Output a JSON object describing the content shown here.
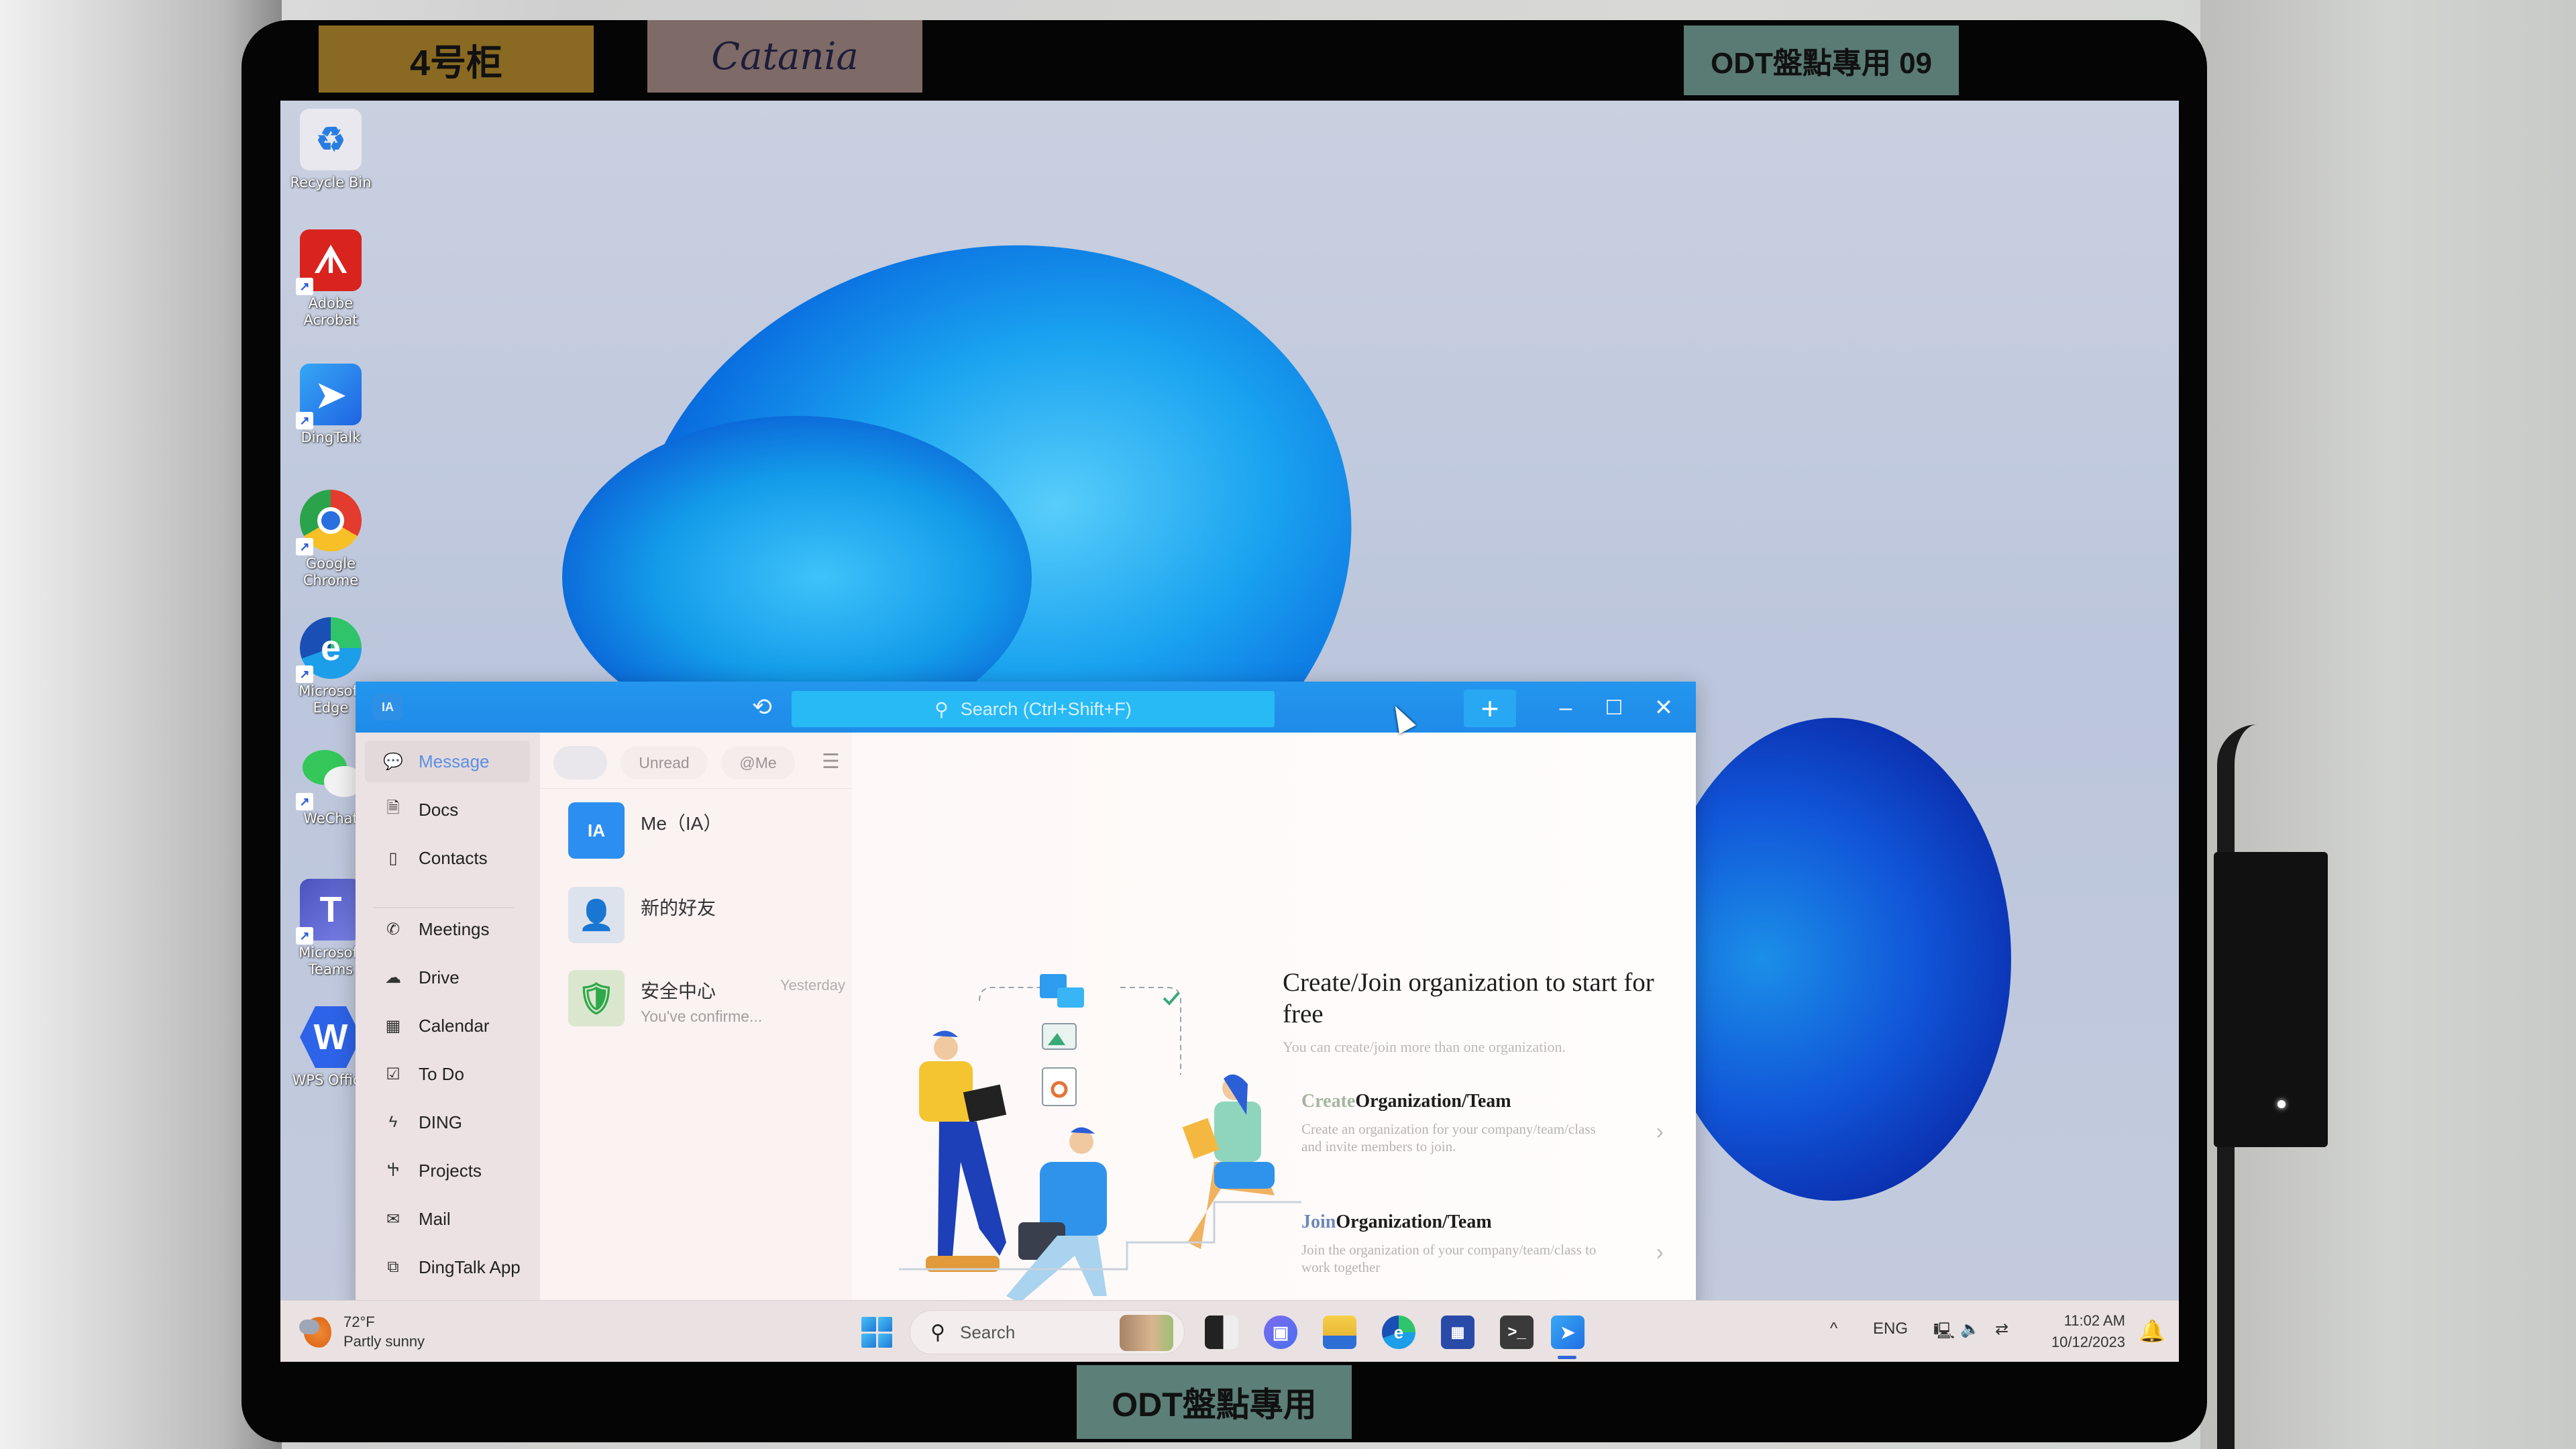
{
  "photo_labels": {
    "cabinet_sticker": "4号柜",
    "handwritten_sticker": "Catania",
    "odt_sticker_top": "ODT盤點專用 09",
    "odt_sticker_bottom": "ODT盤點專用"
  },
  "desktop": {
    "icons": [
      {
        "label": "Recycle Bin",
        "icon": "recycle-bin-icon"
      },
      {
        "label": "Adobe Acrobat",
        "icon": "adobe-acrobat-icon"
      },
      {
        "label": "DingTalk",
        "icon": "dingtalk-icon"
      },
      {
        "label": "Google Chrome",
        "icon": "chrome-icon"
      },
      {
        "label": "Microsoft Edge",
        "icon": "edge-icon"
      },
      {
        "label": "WeChat",
        "icon": "wechat-icon"
      },
      {
        "label": "Microsoft Teams",
        "icon": "teams-icon"
      },
      {
        "label": "WPS Office",
        "icon": "wps-office-icon"
      }
    ]
  },
  "dingtalk": {
    "titlebar": {
      "avatar": "IA",
      "search_placeholder": "Search (Ctrl+Shift+F)",
      "plus": "+",
      "minimize": "–",
      "maximize": "☐",
      "close": "✕"
    },
    "sidebar": {
      "items": [
        {
          "label": "Message",
          "icon": "message-icon",
          "active": true
        },
        {
          "label": "Docs",
          "icon": "docs-icon"
        },
        {
          "label": "Contacts",
          "icon": "contacts-icon"
        },
        {
          "label": "Meetings",
          "icon": "meetings-icon"
        },
        {
          "label": "Drive",
          "icon": "drive-icon"
        },
        {
          "label": "Calendar",
          "icon": "calendar-icon"
        },
        {
          "label": "To Do",
          "icon": "todo-icon"
        },
        {
          "label": "DING",
          "icon": "ding-icon"
        },
        {
          "label": "Projects",
          "icon": "projects-icon"
        },
        {
          "label": "Mail",
          "icon": "mail-icon"
        },
        {
          "label": "DingTalk App",
          "icon": "dingtalk-app-icon"
        }
      ]
    },
    "filters": {
      "unread": "Unread",
      "at_me": "@Me"
    },
    "conversations": [
      {
        "name": "Me（IA）",
        "avatar_text": "IA",
        "preview": "",
        "time": ""
      },
      {
        "name": "新的好友",
        "avatar_text": "",
        "preview": "",
        "time": ""
      },
      {
        "name": "安全中心",
        "avatar_text": "",
        "preview": "You've confirme...",
        "time": "Yesterday"
      }
    ],
    "main": {
      "title": "Create/Join organization to start for free",
      "subtitle": "You can create/join more than one organization.",
      "cards": [
        {
          "lead": "Create",
          "rest": "Organization/Team",
          "desc": "Create an organization for your company/team/class and invite members to join."
        },
        {
          "lead": "Join",
          "rest": "Organization/Team",
          "desc": "Join the organization of your company/team/class to work together"
        }
      ]
    }
  },
  "taskbar": {
    "weather_temp": "72°F",
    "weather_desc": "Partly sunny",
    "search_label": "Search",
    "pinned": [
      "task-view",
      "teams-chat",
      "file-explorer",
      "edge",
      "microsoft-store",
      "terminal",
      "dingtalk"
    ],
    "tray": {
      "chevron": "^",
      "language": "ENG"
    },
    "time": "11:02 AM",
    "date": "10/12/2023"
  }
}
